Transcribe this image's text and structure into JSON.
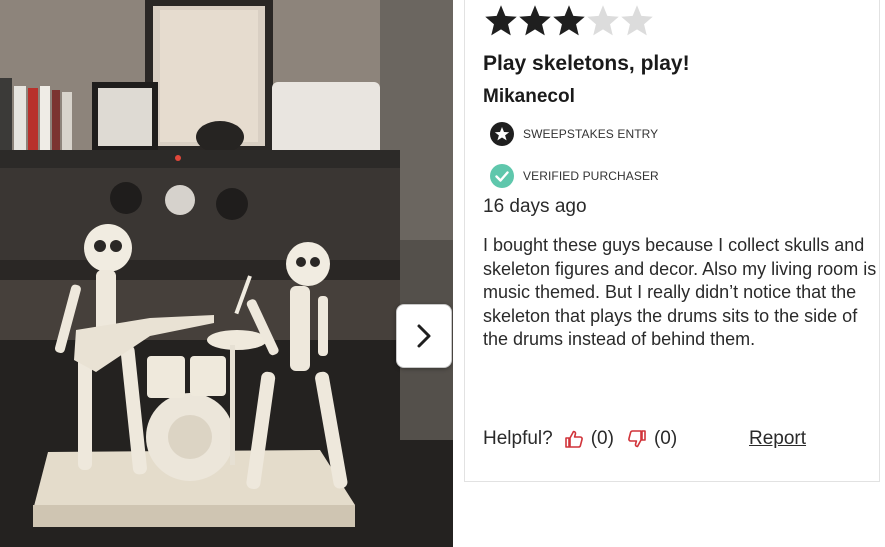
{
  "gallery": {
    "image_description": "skeleton band figurine",
    "next_button_icon": "chevron-right-icon"
  },
  "review": {
    "rating": 3,
    "rating_max": 5,
    "star_color_filled": "#1f1f1f",
    "star_color_empty": "#dcdcdc",
    "title": "Play skeletons, play!",
    "author": "Mikanecol",
    "badges": {
      "sweepstakes": {
        "label": "SWEEPSTAKES ENTRY",
        "icon": "star-circle-icon",
        "color": "#1f1f1f"
      },
      "verified": {
        "label": "VERIFIED PURCHASER",
        "icon": "check-circle-icon",
        "color": "#5fc7ac"
      }
    },
    "date": "16 days ago",
    "body": "I bought these guys because I collect skulls and skeleton figures and decor. Also my living room is music themed. But I really didn’t notice that the skeleton that plays the drums sits to the side of the drums instead of behind them.",
    "helpful": {
      "label": "Helpful?",
      "up_count": "(0)",
      "down_count": "(0)",
      "thumb_color": "#d1343a"
    },
    "report_label": "Report"
  }
}
